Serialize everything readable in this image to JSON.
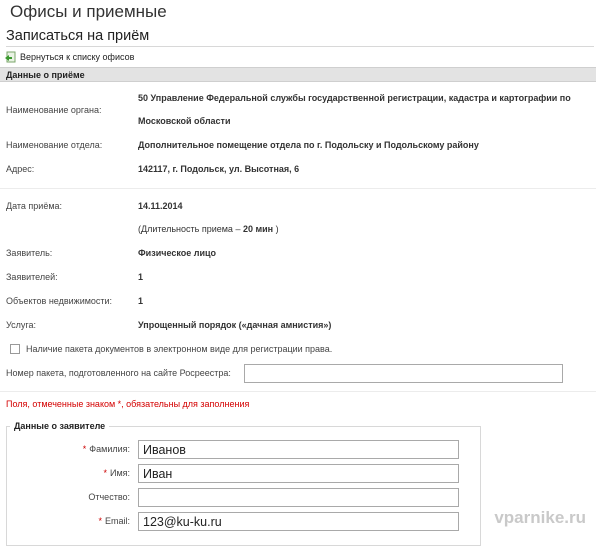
{
  "header": {
    "title": "Офисы и приемные",
    "subtitle": "Записаться на приём"
  },
  "back_link": {
    "label": "Вернуться к списку офисов"
  },
  "section": {
    "title": "Данные о приёме"
  },
  "details": {
    "organ_label": "Наименование органа:",
    "organ_line1": "50 Управление Федеральной службы государственной регистрации, кадастра и картографии по",
    "organ_line2": "Московской области",
    "dept_label": "Наименование отдела:",
    "dept_value": "Дополнительное помещение отдела по г. Подольску и Подольскому району",
    "address_label": "Адрес:",
    "address_value": "142117, г. Подольск, ул. Высотная, 6",
    "date_label": "Дата приёма:",
    "date_value": "14.11.2014",
    "duration_prefix": "(Длительность приема",
    "duration_dash": "–",
    "duration_value": "20 мин",
    "duration_suffix": ")",
    "applicant_label": "Заявитель:",
    "applicant_value": "Физическое лицо",
    "applicants_count_label": "Заявителей:",
    "applicants_count_value": "1",
    "objects_label": "Объектов недвижимости:",
    "objects_value": "1",
    "service_label": "Услуга:",
    "service_value": "Упрощенный порядок («дачная амнистия»)"
  },
  "checkbox": {
    "label": "Наличие пакета документов в электронном виде для регистрации права.",
    "checked": false
  },
  "package": {
    "label": "Номер пакета, подготовленного на сайте Росреестра:",
    "value": ""
  },
  "required_note": "Поля, отмеченные знаком *, обязательны для заполнения",
  "applicant_form": {
    "legend": "Данные о заявителе",
    "required_mark": "*",
    "surname_label": "Фамилия:",
    "surname_value": "Иванов",
    "name_label": "Имя:",
    "name_value": "Иван",
    "patronymic_label": "Отчество:",
    "patronymic_value": "",
    "email_label": "Email:",
    "email_value": "123@ku-ku.ru"
  },
  "watermark": "vparnike.ru"
}
